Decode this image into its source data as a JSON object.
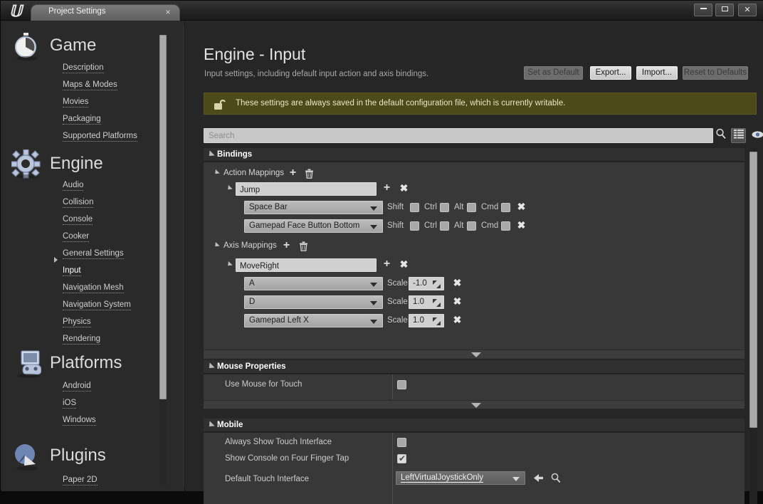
{
  "window": {
    "app_logo": "unreal-engine-logo",
    "tab_label": "Project Settings",
    "tab_close": "×",
    "minimize_label": "",
    "maximize_label": "",
    "close_label": "✕"
  },
  "sidebar": {
    "categories": [
      {
        "title": "Game",
        "icon": "stopwatch-icon",
        "items": [
          {
            "label": "Description",
            "selected": false
          },
          {
            "label": "Maps & Modes",
            "selected": false
          },
          {
            "label": "Movies",
            "selected": false
          },
          {
            "label": "Packaging",
            "selected": false
          },
          {
            "label": "Supported Platforms",
            "selected": false
          }
        ]
      },
      {
        "title": "Engine",
        "icon": "gear-icon",
        "items": [
          {
            "label": "Audio",
            "selected": false
          },
          {
            "label": "Collision",
            "selected": false
          },
          {
            "label": "Console",
            "selected": false
          },
          {
            "label": "Cooker",
            "selected": false
          },
          {
            "label": "General Settings",
            "selected": false
          },
          {
            "label": "Input",
            "selected": true
          },
          {
            "label": "Navigation Mesh",
            "selected": false
          },
          {
            "label": "Navigation System",
            "selected": false
          },
          {
            "label": "Physics",
            "selected": false
          },
          {
            "label": "Rendering",
            "selected": false
          }
        ]
      },
      {
        "title": "Platforms",
        "icon": "gamepad-monitor-icon",
        "items": [
          {
            "label": "Android",
            "selected": false
          },
          {
            "label": "iOS",
            "selected": false
          },
          {
            "label": "Windows",
            "selected": false
          }
        ]
      },
      {
        "title": "Plugins",
        "icon": "plugin-sphere-icon",
        "items": [
          {
            "label": "Paper 2D",
            "selected": false
          }
        ]
      }
    ]
  },
  "page": {
    "title": "Engine - Input",
    "subtitle": "Input settings, including default input action and axis bindings.",
    "buttons": [
      {
        "label": "Set as Default",
        "enabled": false
      },
      {
        "label": "Export...",
        "enabled": true
      },
      {
        "label": "Import...",
        "enabled": true
      },
      {
        "label": "Reset to Defaults",
        "enabled": false
      }
    ],
    "notice": {
      "icon": "unlocked-padlock-icon",
      "text": "These settings are always saved in the default configuration file, which is currently writable.",
      "bg_color": "#4c4a18"
    },
    "search": {
      "value": "",
      "placeholder": "Search",
      "go_icon": "magnifier-icon",
      "list_view_icon": "grid-list-icon",
      "filter_icon": "eye-icon",
      "filter_caret": "▾"
    }
  },
  "bindings": {
    "section_label": "Bindings",
    "action_mappings": {
      "label": "Action Mappings",
      "add_icon": "plus-icon",
      "delete_icon": "trash-icon",
      "groups": [
        {
          "name": "Jump",
          "add_icon": "plus-icon",
          "remove_icon": "x-icon",
          "keys": [
            {
              "key": "Space Bar",
              "modifiers": [
                {
                  "label": "Shift",
                  "checked": false
                },
                {
                  "label": "Ctrl",
                  "checked": false
                },
                {
                  "label": "Alt",
                  "checked": false
                },
                {
                  "label": "Cmd",
                  "checked": false
                }
              ],
              "remove_icon": "x-icon"
            },
            {
              "key": "Gamepad Face Button Bottom",
              "modifiers": [
                {
                  "label": "Shift",
                  "checked": false
                },
                {
                  "label": "Ctrl",
                  "checked": false
                },
                {
                  "label": "Alt",
                  "checked": false
                },
                {
                  "label": "Cmd",
                  "checked": false
                }
              ],
              "remove_icon": "x-icon"
            }
          ]
        }
      ]
    },
    "axis_mappings": {
      "label": "Axis Mappings",
      "add_icon": "plus-icon",
      "delete_icon": "trash-icon",
      "groups": [
        {
          "name": "MoveRight",
          "add_icon": "plus-icon",
          "remove_icon": "x-icon",
          "keys": [
            {
              "key": "A",
              "scale_label": "Scale",
              "scale": "-1.0",
              "remove_icon": "x-icon"
            },
            {
              "key": "D",
              "scale_label": "Scale",
              "scale": "1.0",
              "remove_icon": "x-icon"
            },
            {
              "key": "Gamepad Left X",
              "scale_label": "Scale",
              "scale": "1.0",
              "remove_icon": "x-icon"
            }
          ]
        }
      ]
    },
    "expand_more_icon": "chevron-down-icon"
  },
  "mouse_properties": {
    "section_label": "Mouse Properties",
    "rows": [
      {
        "name": "Use Mouse for Touch",
        "type": "checkbox",
        "checked": false
      }
    ]
  },
  "mobile": {
    "section_label": "Mobile",
    "rows": [
      {
        "name": "Always Show Touch Interface",
        "type": "checkbox",
        "checked": false
      },
      {
        "name": "Show Console on Four Finger Tap",
        "type": "checkbox",
        "checked": true
      },
      {
        "name": "Default Touch Interface",
        "type": "asset",
        "value": "LeftVirtualJoystickOnly",
        "use_icon": "back-arrow-icon",
        "browse_icon": "magnifier-icon"
      }
    ]
  }
}
